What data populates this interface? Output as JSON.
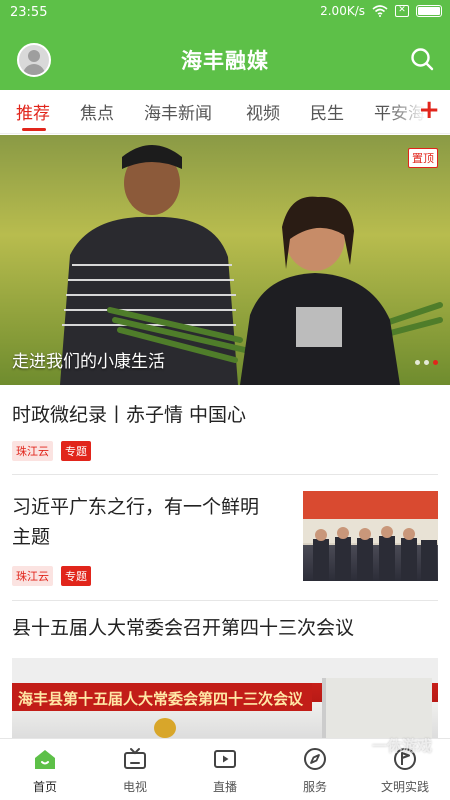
{
  "status_bar": {
    "time": "23:55",
    "network_speed": "2.00K/s",
    "sim_label": "✕"
  },
  "header": {
    "title": "海丰融媒"
  },
  "tabs": [
    {
      "label": "推荐",
      "active": true
    },
    {
      "label": "焦点"
    },
    {
      "label": "海丰新闻"
    },
    {
      "label": "视频"
    },
    {
      "label": "民生"
    },
    {
      "label": "平安海"
    }
  ],
  "tab_add_label": "+",
  "banner": {
    "pin_label": "置顶",
    "caption": "走进我们的小康生活"
  },
  "news": [
    {
      "title": "时政微纪录丨赤子情 中国心",
      "source": "珠江云",
      "tag": "专题"
    },
    {
      "title_line1": "习近平广东之行，有一个鲜明",
      "title_line2": "主题",
      "source": "珠江云",
      "tag": "专题"
    },
    {
      "title": "县十五届人大常委会召开第四十三次会议",
      "image_banner": "海丰县第十五届人大常委会第四十三次会议"
    }
  ],
  "bottom_nav": [
    {
      "label": "首页",
      "icon": "home-icon",
      "active": true
    },
    {
      "label": "电视",
      "icon": "tv-icon"
    },
    {
      "label": "直播",
      "icon": "live-icon"
    },
    {
      "label": "服务",
      "icon": "compass-icon"
    },
    {
      "label": "文明实践",
      "icon": "flag-circle-icon"
    }
  ],
  "colors": {
    "brand_green": "#5dc048",
    "accent_red": "#e1251b"
  },
  "watermark": "一休游戏"
}
